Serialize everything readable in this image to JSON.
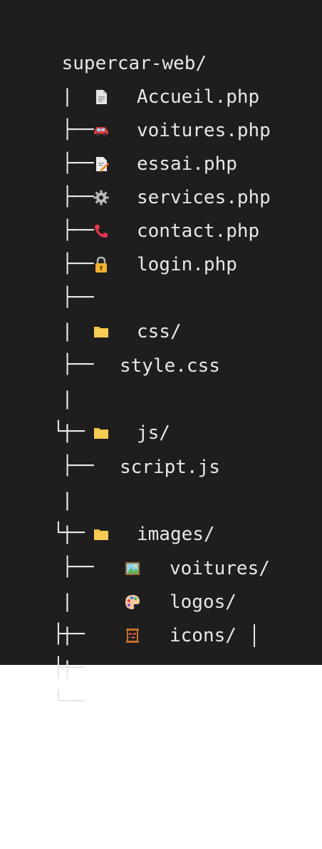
{
  "root": {
    "label": "supercar-web/"
  },
  "tree_pipe": "|",
  "branch": "├──",
  "last_branch": "└──",
  "files": [
    {
      "name": "Accueil.php",
      "icon": "document-icon"
    },
    {
      "name": "voitures.php",
      "icon": "car-icon"
    },
    {
      "name": "essai.php",
      "icon": "memo-icon"
    },
    {
      "name": "services.php",
      "icon": "gear-icon"
    },
    {
      "name": "contact.php",
      "icon": "phone-icon"
    },
    {
      "name": "login.php",
      "icon": "lock-icon"
    }
  ],
  "folders": {
    "css": {
      "name": "css/",
      "child": "style.css"
    },
    "js": {
      "name": "js/",
      "child": "script.js"
    },
    "images": {
      "name": "images/",
      "children": [
        {
          "name": "voitures/",
          "icon": "picture-icon"
        },
        {
          "name": "logos/",
          "icon": "palette-icon"
        },
        {
          "name": "icons/",
          "icon": "abacus-icon"
        }
      ]
    }
  },
  "colors": {
    "background": "#1e1e1e",
    "text": "#e8e8e8",
    "folder": "#f4c145"
  }
}
